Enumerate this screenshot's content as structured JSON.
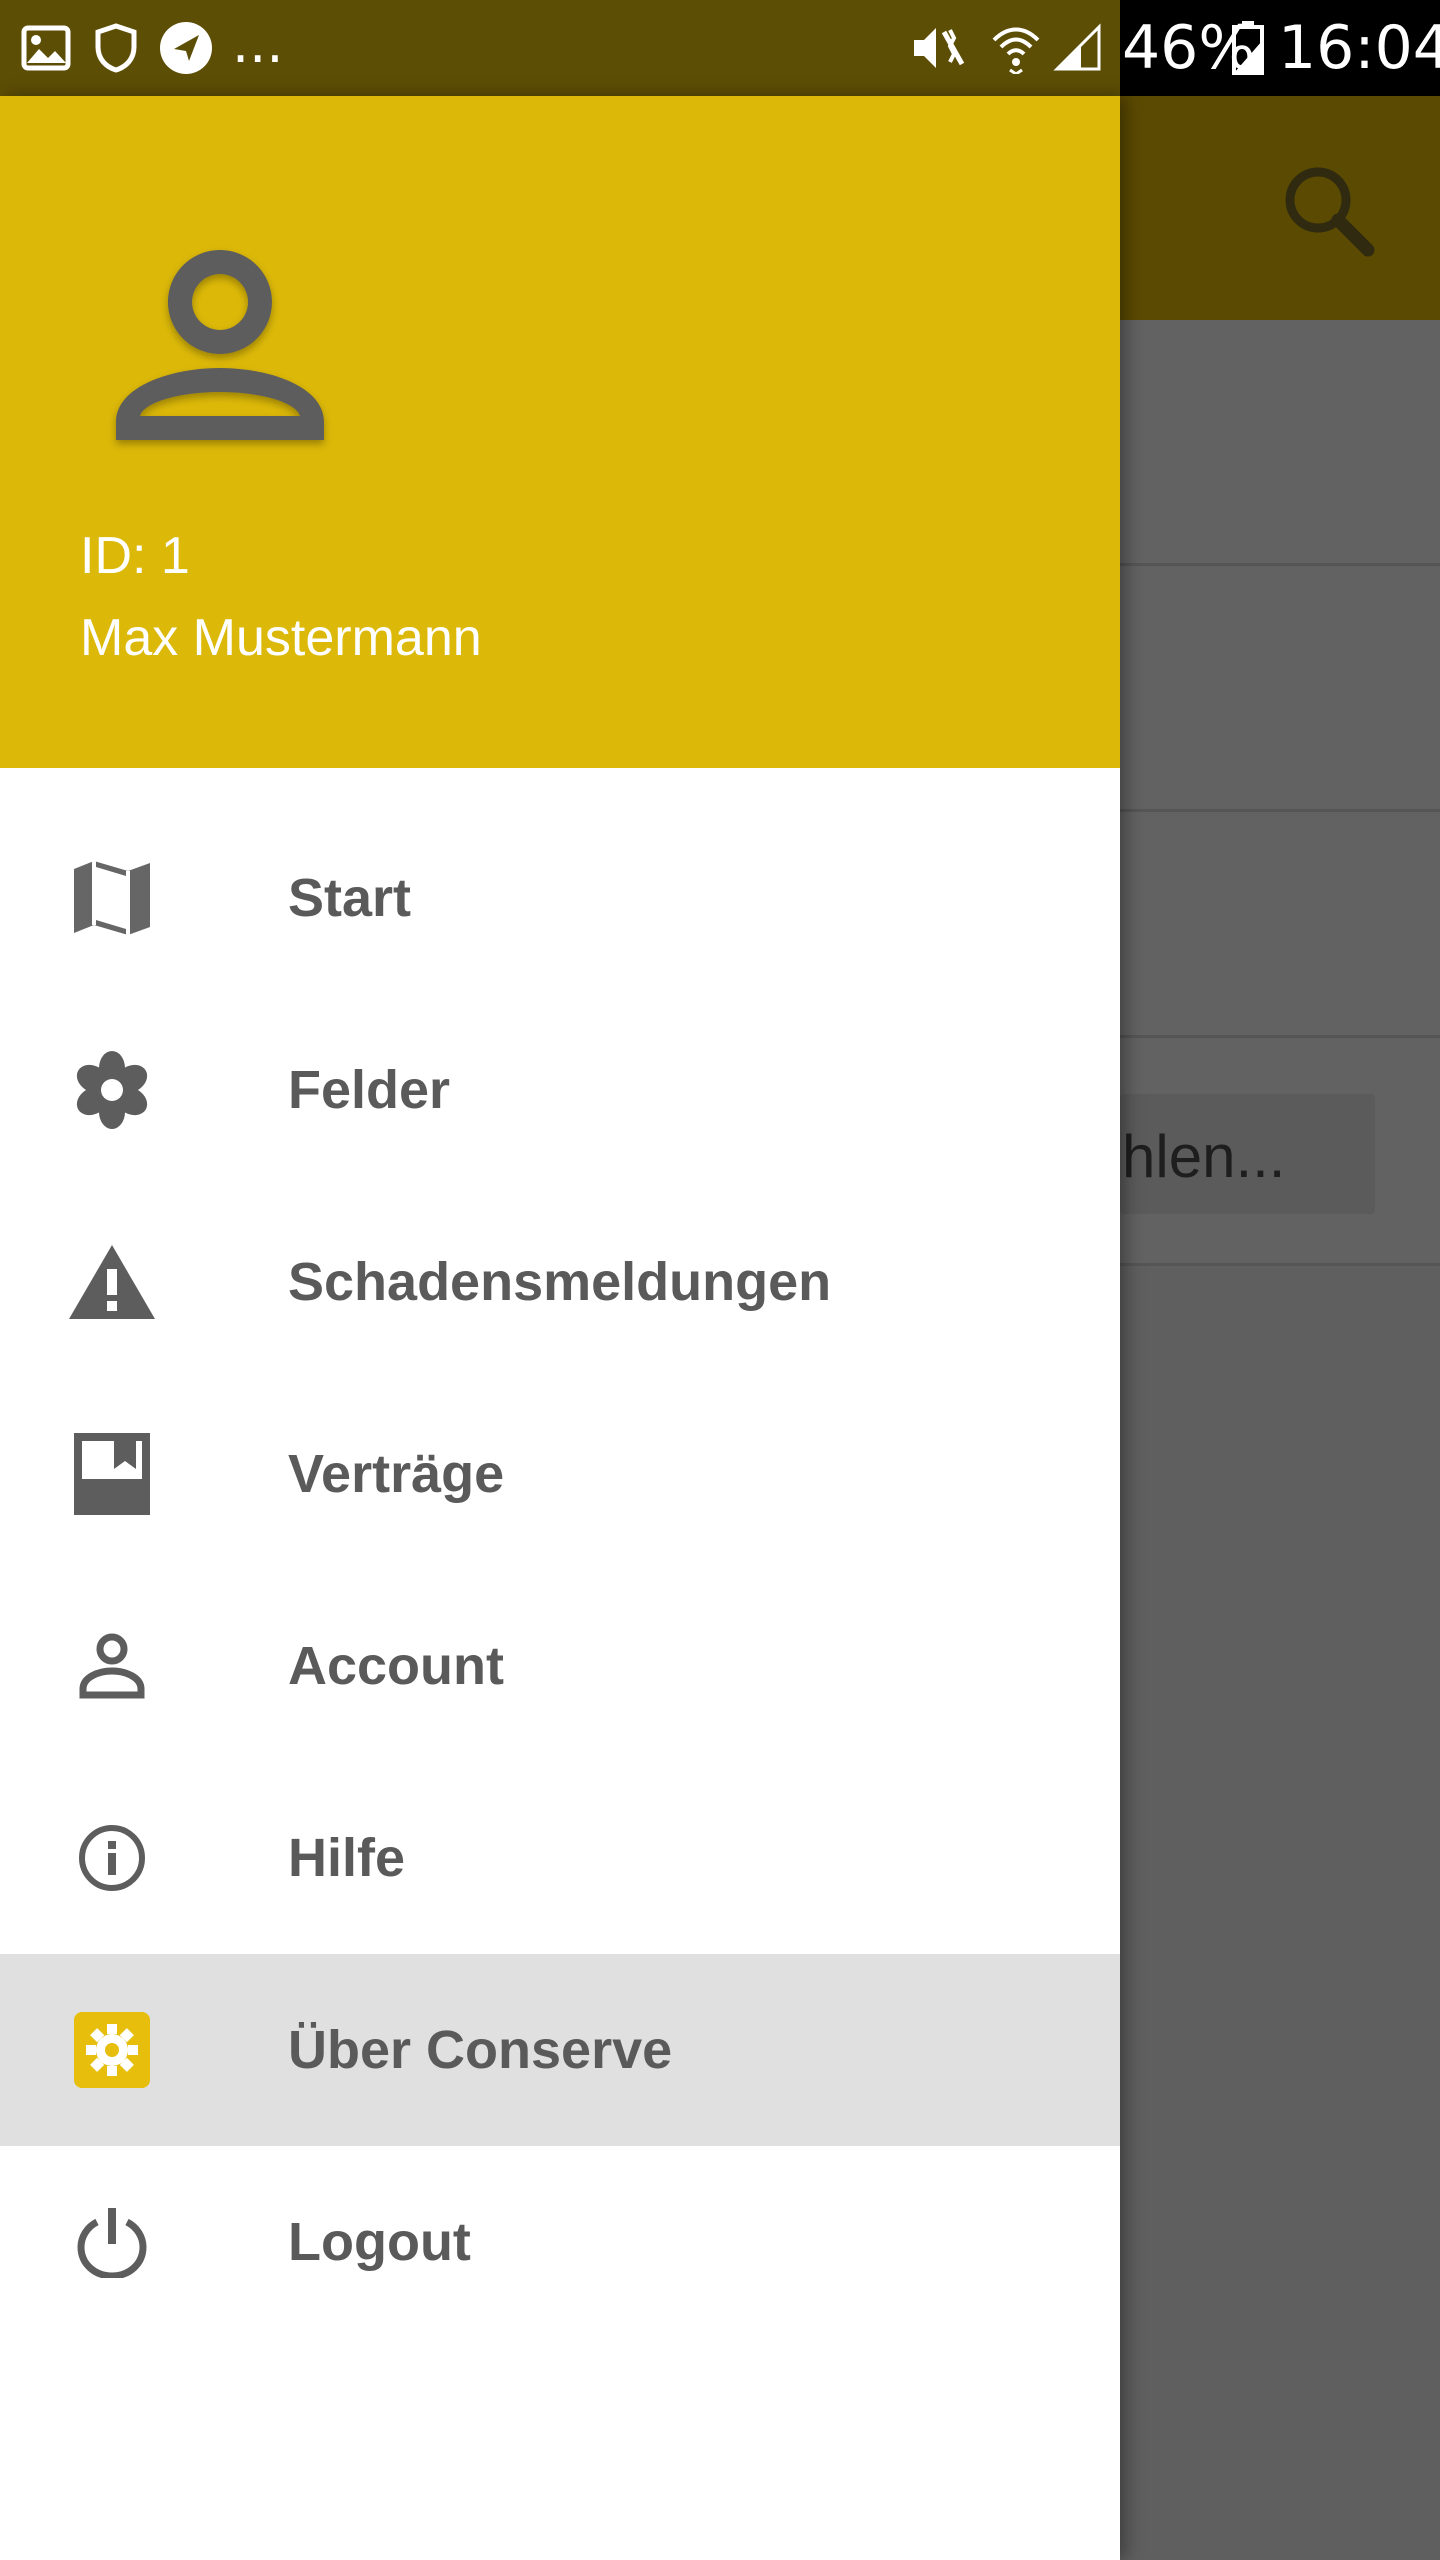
{
  "status_bar": {
    "left_more": "...",
    "battery": "46%",
    "time": "16:04"
  },
  "background": {
    "field_text": "hlen..."
  },
  "drawer": {
    "header": {
      "user_id": "ID: 1",
      "user_name": "Max Mustermann"
    },
    "items": [
      {
        "label": "Start",
        "icon": "map-icon",
        "active": false
      },
      {
        "label": "Felder",
        "icon": "flower-icon",
        "active": false
      },
      {
        "label": "Schadensmeldungen",
        "icon": "warning-icon",
        "active": false
      },
      {
        "label": "Verträge",
        "icon": "book-icon",
        "active": false
      },
      {
        "label": "Account",
        "icon": "person-icon",
        "active": false
      },
      {
        "label": "Hilfe",
        "icon": "info-icon",
        "active": false
      },
      {
        "label": "Über Conserve",
        "icon": "settings-icon",
        "active": true
      },
      {
        "label": "Logout",
        "icon": "power-icon",
        "active": false
      }
    ]
  },
  "colors": {
    "header": "#dcb808",
    "accent": "#e6be0b",
    "text": "#5a5a5a",
    "active_row": "#e0e0e0"
  }
}
